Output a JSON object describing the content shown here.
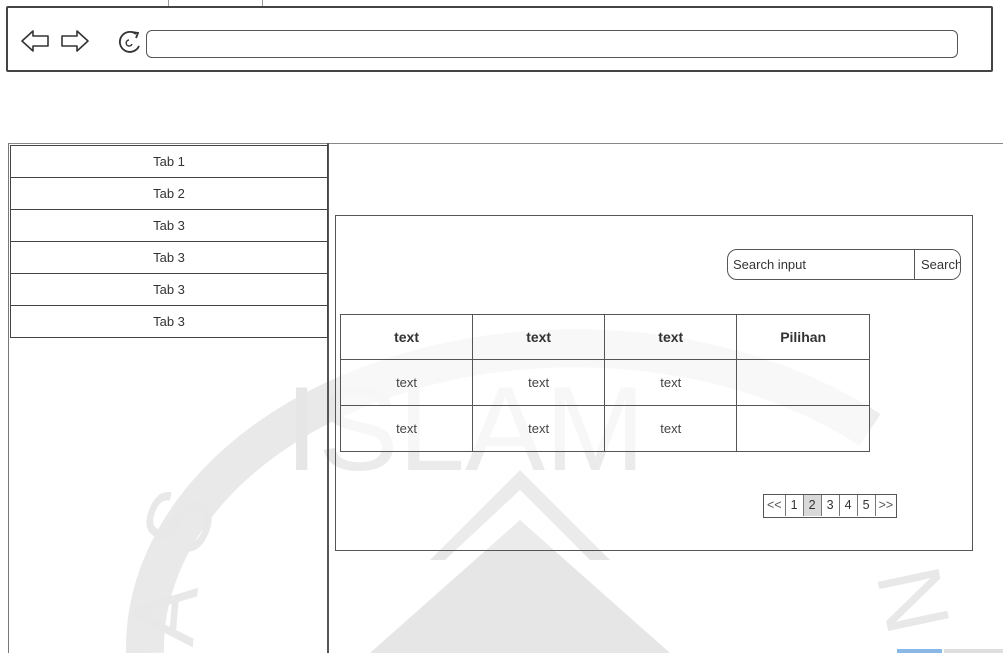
{
  "browser": {
    "back_icon": "arrow-left-outline-icon",
    "forward_icon": "arrow-right-outline-icon",
    "reload_icon": "reload-icon",
    "address_value": ""
  },
  "sidebar": {
    "tabs": [
      {
        "label": "Tab 1"
      },
      {
        "label": "Tab 2"
      },
      {
        "label": "Tab 3"
      },
      {
        "label": "Tab 3"
      },
      {
        "label": "Tab 3"
      },
      {
        "label": "Tab 3"
      }
    ]
  },
  "search": {
    "placeholder": "Search input",
    "button_label": "Search"
  },
  "table": {
    "headers": [
      "text",
      "text",
      "text",
      "Pilihan"
    ],
    "rows": [
      [
        "text",
        "text",
        "text",
        ""
      ],
      [
        "text",
        "text",
        "text",
        ""
      ]
    ]
  },
  "pagination": {
    "prev_label": "<<",
    "pages": [
      "1",
      "2",
      "3",
      "4",
      "5"
    ],
    "current_page": "2",
    "next_label": ">>"
  },
  "watermark": {
    "text": "ISLAM",
    "arc_letters": [
      "A",
      "S",
      "N",
      "I"
    ]
  },
  "colors": {
    "outline": "#444444",
    "active_page": "#d9d9d9",
    "watermark": "#e9e9e9",
    "corner_blue": "#8ab8e6"
  }
}
